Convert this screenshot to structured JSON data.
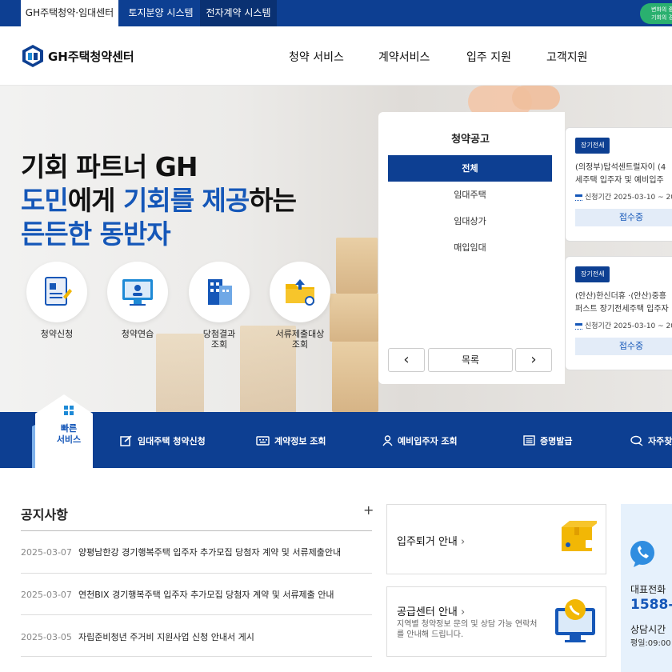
{
  "topbar": {
    "tabs": [
      {
        "label": "GH주택청약·임대센터"
      },
      {
        "label": "토지분양 시스템"
      },
      {
        "label": "전자계약 시스템"
      }
    ],
    "badge_line1": "변화의 중",
    "badge_line2": "기회의 경"
  },
  "header": {
    "logo_text": "GH주택청약센터",
    "nav": [
      "청약 서비스",
      "계약서비스",
      "입주 지원",
      "고객지원"
    ]
  },
  "hero": {
    "line1": "기회 파트너 GH",
    "line2_a": "도민",
    "line2_b": "에게 ",
    "line2_c": "기회",
    "line2_d": "를 ",
    "line2_e": "제공",
    "line2_f": "하는",
    "line3": "든든한 동반자",
    "services": [
      {
        "label": "청약신청"
      },
      {
        "label": "청약연습"
      },
      {
        "label": "당첨결과\n조회"
      },
      {
        "label": "서류제출대상\n조회"
      }
    ]
  },
  "panel": {
    "title": "청약공고",
    "menu": [
      "전체",
      "임대주택",
      "임대상가",
      "매입임대"
    ],
    "prev_symbol": "‹",
    "list_label": "목록",
    "next_symbol": "›"
  },
  "cards": [
    {
      "tag": "장기전세",
      "title1": "(의정부)탑석센트럴자이 (4",
      "title2": "세주택 입주자 및 예비입주",
      "date": "신청기간 2025-03-10 ~ 20",
      "status": "접수중"
    },
    {
      "tag": "장기전세",
      "title1": "(안산)한신더휴 ·(안산)중흥",
      "title2": "퍼스트 장기전세주택 입주자",
      "date": "신청기간 2025-03-10 ~ 20",
      "status": "접수중"
    }
  ],
  "quick": {
    "house_line1": "빠른",
    "house_line2": "서비스",
    "items": [
      {
        "label": "임대주택 청약신청"
      },
      {
        "label": "계약정보 조회"
      },
      {
        "label": "예비입주자 조회"
      },
      {
        "label": "증명발급"
      },
      {
        "label": "자주찾"
      }
    ]
  },
  "notice": {
    "title": "공지사항",
    "plus": "+",
    "rows": [
      {
        "date": "2025-03-07",
        "text": "양평남한강 경기행복주택 입주자 추가모집 당첨자 계약 및 서류제출안내"
      },
      {
        "date": "2025-03-07",
        "text": "연천BIX 경기행복주택 입주자 추가모집 당첨자 계약 및 서류제출 안내"
      },
      {
        "date": "2025-03-05",
        "text": "자립준비청년 주거비 지원사업 신청 안내서 게시"
      }
    ]
  },
  "boxes": [
    {
      "title": "입주퇴거 안내",
      "arrow": "›"
    },
    {
      "title": "공급센터 안내",
      "arrow": "›",
      "desc1": "지역별 청약정보 문의 및 상담 가능 연락처",
      "desc2": "를 안내해 드립니다."
    }
  ],
  "call": {
    "label": "대표전화",
    "number": "1588-0",
    "hours_label": "상담시간",
    "hours": "평일:09:00"
  },
  "colors": {
    "primary": "#0d3f92",
    "accent": "#1557b8",
    "green": "#2ab06f"
  }
}
